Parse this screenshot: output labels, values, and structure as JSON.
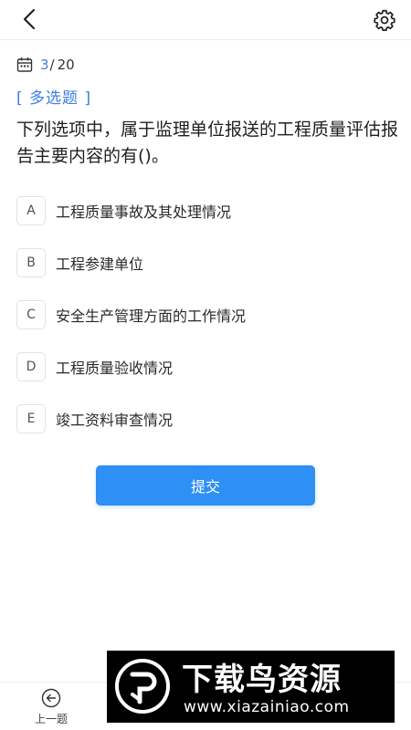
{
  "header": {
    "back_icon": "chevron-left-icon",
    "settings_icon": "gear-icon"
  },
  "progress": {
    "icon": "calendar-icon",
    "current": "3",
    "separator": "/",
    "total": "20"
  },
  "question": {
    "type_label": "[ 多选题 ]",
    "text": "下列选项中，属于监理单位报送的工程质量评估报告主要内容的有()。"
  },
  "options": [
    {
      "letter": "A",
      "text": "工程质量事故及其处理情况"
    },
    {
      "letter": "B",
      "text": "工程参建单位"
    },
    {
      "letter": "C",
      "text": "安全生产管理方面的工作情况"
    },
    {
      "letter": "D",
      "text": "工程质量验收情况"
    },
    {
      "letter": "E",
      "text": "竣工资料审查情况"
    }
  ],
  "submit_label": "提交",
  "bottom_nav": {
    "prev_label": "上一题",
    "prev_icon": "arrow-left-circle-icon"
  },
  "watermark": {
    "title": "下载鸟资源",
    "url": "www.xiazainiao.com"
  },
  "colors": {
    "accent": "#3d7fe0",
    "button": "#2e8ff4"
  }
}
